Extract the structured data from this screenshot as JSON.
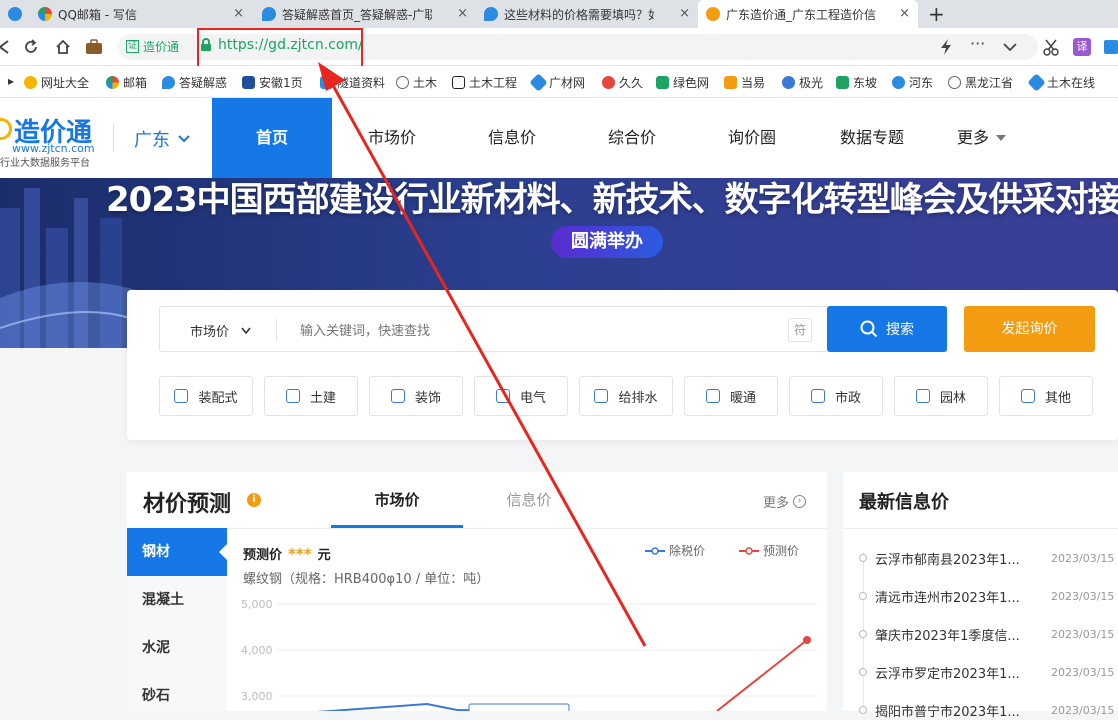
{
  "browser": {
    "tabs": [
      {
        "title": "QQ邮箱 - 写信",
        "color": "#e8453c",
        "active": false
      },
      {
        "title": "答疑解惑首页_答疑解惑-广联达",
        "color": "#2a8ce0",
        "active": false
      },
      {
        "title": "这些材料的价格需要填吗？如果",
        "color": "#2a8ce0",
        "active": false
      },
      {
        "title": "广东造价通_广东工程造价信息",
        "color": "#f39c12",
        "active": true
      }
    ],
    "new_tab": "+",
    "close_glyph": "×",
    "badge": "造价通",
    "url": "https://gd.zjtcn.com/",
    "bookmarks": [
      "网址大全",
      "邮箱",
      "答疑解惑",
      "安徽1页",
      "隧道资料",
      "土木",
      "土木工程",
      "广材网",
      "久久",
      "绿色网",
      "当易",
      "极光",
      "东坡",
      "河东",
      "黑龙江省",
      "土木在线"
    ]
  },
  "header": {
    "logo_text": "造价通",
    "logo_url": "www.zjtcn.com",
    "logo_slogan": "行业大数据服务平台",
    "region": "广东",
    "nav": [
      "首页",
      "市场价",
      "信息价",
      "综合价",
      "询价圈",
      "数据专题",
      "更多"
    ]
  },
  "banner": {
    "headline": "2023中国西部建设行业新材料、新技术、数字化转型峰会及供采对接",
    "badge": "圆满举办"
  },
  "search": {
    "type": "市场价",
    "placeholder": "输入关键词，快速查找",
    "symbol": "符",
    "search_button": "搜索",
    "inquiry_button": "发起询价",
    "categories": [
      "装配式",
      "土建",
      "装饰",
      "电气",
      "给排水",
      "暖通",
      "市政",
      "园林",
      "其他"
    ]
  },
  "forecast": {
    "title": "材价预测",
    "tabs": [
      "市场价",
      "信息价"
    ],
    "more": "更多",
    "materials": [
      "钢材",
      "混凝土",
      "水泥",
      "砂石"
    ],
    "price_label": "预测价",
    "price_stars": "***",
    "price_unit": "元",
    "spec": "螺纹钢（规格：HRB400φ10 / 单位：吨）",
    "legend": [
      "除税价",
      "预测价"
    ]
  },
  "chart_data": {
    "type": "line",
    "y_ticks": [
      "5,000",
      "4,000",
      "3,000"
    ],
    "ylim": [
      3000,
      5000
    ],
    "series": [
      {
        "name": "除税价",
        "color": "#3b78d8"
      },
      {
        "name": "预测价",
        "color": "#e8453c"
      }
    ]
  },
  "news": {
    "title": "最新信息价",
    "items": [
      {
        "title": "云浮市郁南县2023年1...",
        "date": "2023/03/15"
      },
      {
        "title": "清远市连州市2023年1...",
        "date": "2023/03/15"
      },
      {
        "title": "肇庆市2023年1季度信...",
        "date": "2023/03/15"
      },
      {
        "title": "云浮市罗定市2023年1...",
        "date": "2023/03/15"
      },
      {
        "title": "揭阳市普宁市2023年1...",
        "date": "2023/03/15"
      }
    ]
  },
  "colors": {
    "accent": "#1678e6",
    "orange": "#f39c12",
    "annotation": "#e8261f"
  }
}
